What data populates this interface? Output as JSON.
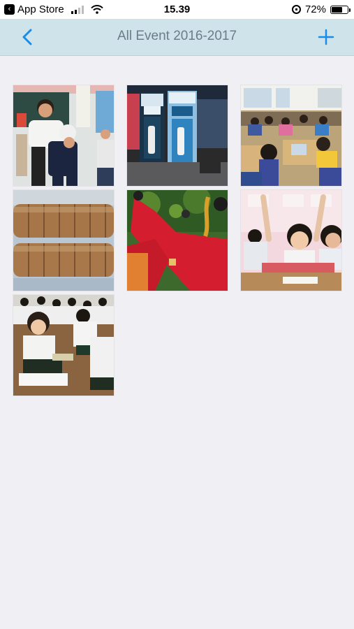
{
  "status": {
    "back_app": "App Store",
    "time": "15.39",
    "battery": "72%",
    "battery_level": 0.72
  },
  "nav": {
    "title": "All Event 2016-2017",
    "back_icon": "chevron-left-icon",
    "add_icon": "plus-icon",
    "accent_color": "#1a8ce8"
  },
  "photos": [
    {
      "name": "teacher-with-children"
    },
    {
      "name": "epson-ink-boxes"
    },
    {
      "name": "classroom-desks"
    },
    {
      "name": "bread-rolls"
    },
    {
      "name": "dancer-red-costume"
    },
    {
      "name": "children-raising-hands"
    },
    {
      "name": "students-sitting-floor"
    }
  ]
}
